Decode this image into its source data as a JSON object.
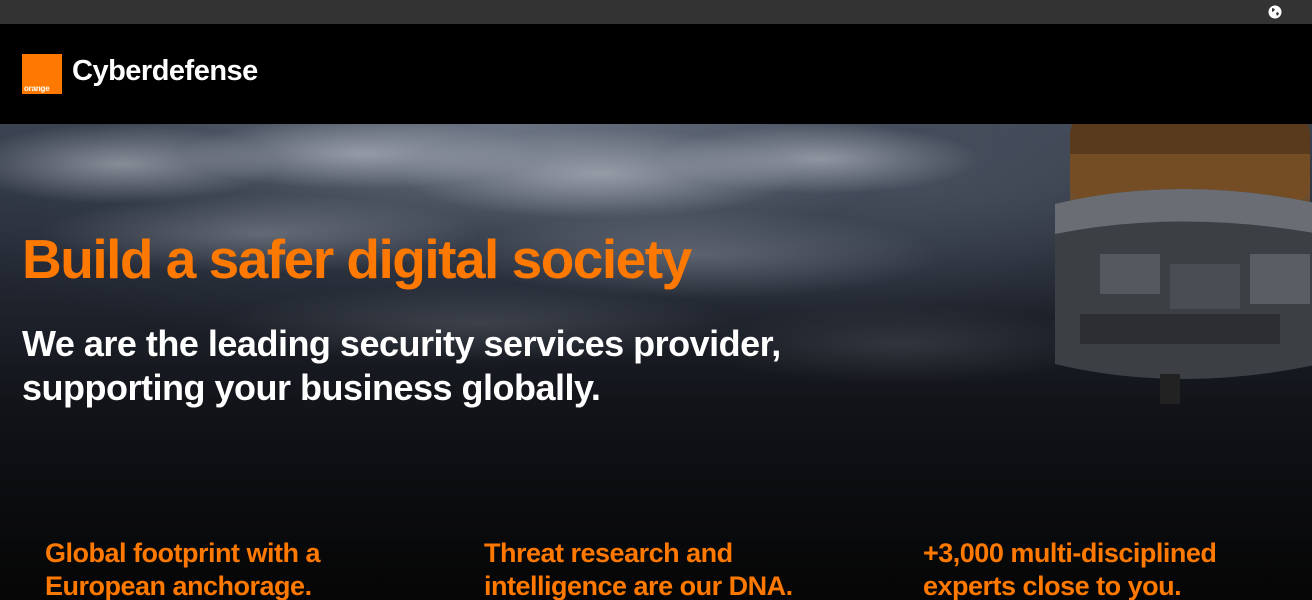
{
  "topbar": {
    "language_icon": "globe-icon"
  },
  "header": {
    "logo_text": "orange",
    "brand": "Cyberdefense"
  },
  "hero": {
    "title": "Build a safer digital society",
    "subtitle_line1": "We are the leading security services provider,",
    "subtitle_line2": "supporting your business globally."
  },
  "features": [
    {
      "line1": "Global footprint with a",
      "line2": "European anchorage."
    },
    {
      "line1": "Threat research and",
      "line2": "intelligence are our DNA."
    },
    {
      "line1": "+3,000 multi-disciplined",
      "line2": "experts close to you."
    }
  ],
  "colors": {
    "accent": "#ff7900",
    "topbar": "#333333",
    "header": "#000000"
  }
}
